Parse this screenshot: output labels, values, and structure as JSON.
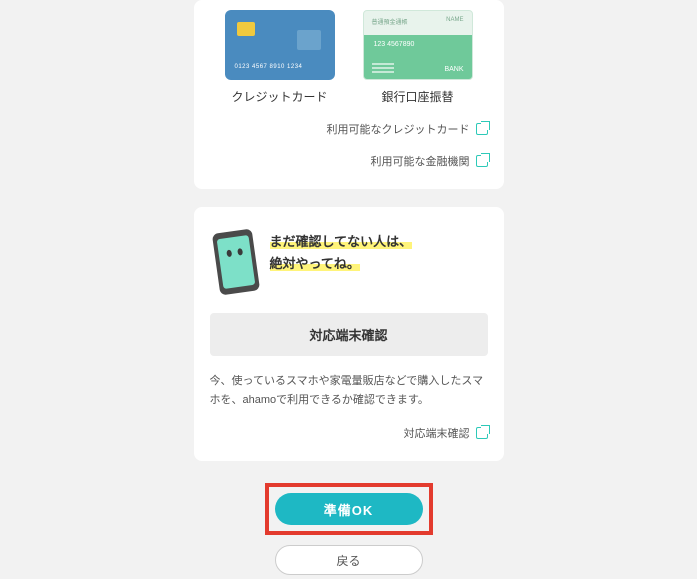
{
  "payment": {
    "credit": {
      "label": "クレジットカード",
      "sample_number": "0123 4567 8910 1234"
    },
    "bank": {
      "label": "銀行口座振替",
      "header_left": "普通預金通帳",
      "header_right": "NAME",
      "account": "123 4567890",
      "bank_label": "BANK"
    },
    "links": {
      "credit": "利用可能なクレジットカード",
      "bank": "利用可能な金融機関"
    }
  },
  "device": {
    "notice_line1": "まだ確認してない人は、",
    "notice_line2": "絶対やってね。",
    "button": "対応端末確認",
    "desc": "今、使っているスマホや家電量販店などで購入したスマホを、ahamoで利用できるか確認できます。",
    "link": "対応端末確認"
  },
  "actions": {
    "ok": "準備OK",
    "back": "戻る"
  }
}
